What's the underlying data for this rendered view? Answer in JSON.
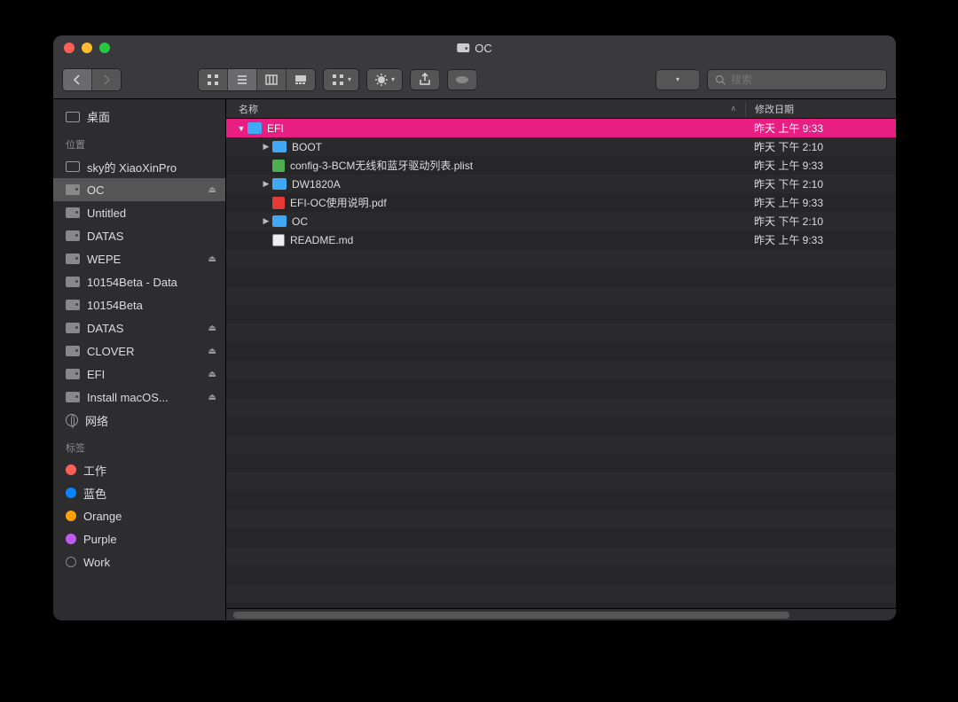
{
  "window_title": "OC",
  "search": {
    "placeholder": "搜索"
  },
  "toolbar": {
    "back": "‹",
    "forward": "›"
  },
  "sidebar": {
    "favorites_top": {
      "label": "桌面"
    },
    "locations_heading": "位置",
    "items": [
      {
        "label": "sky的 XiaoXinPro",
        "kind": "desktop",
        "eject": false
      },
      {
        "label": "OC",
        "kind": "drive",
        "eject": true,
        "selected": true
      },
      {
        "label": "Untitled",
        "kind": "drive",
        "eject": false
      },
      {
        "label": "DATAS",
        "kind": "drive",
        "eject": false
      },
      {
        "label": "WEPE",
        "kind": "drive",
        "eject": true
      },
      {
        "label": "10154Beta - Data",
        "kind": "drive",
        "eject": false
      },
      {
        "label": "10154Beta",
        "kind": "drive",
        "eject": false
      },
      {
        "label": "DATAS",
        "kind": "drive",
        "eject": true
      },
      {
        "label": "CLOVER",
        "kind": "drive",
        "eject": true
      },
      {
        "label": "EFI",
        "kind": "drive",
        "eject": true
      },
      {
        "label": "Install macOS...",
        "kind": "drive",
        "eject": true
      },
      {
        "label": "网络",
        "kind": "globe",
        "eject": false
      }
    ],
    "tags_heading": "标签",
    "tags": [
      {
        "label": "工作",
        "color": "#ff5f57"
      },
      {
        "label": "蓝色",
        "color": "#0a84ff"
      },
      {
        "label": "Orange",
        "color": "#ff9f0a"
      },
      {
        "label": "Purple",
        "color": "#bf5af2"
      },
      {
        "label": "Work",
        "color": ""
      }
    ]
  },
  "columns": {
    "name": "名称",
    "date": "修改日期"
  },
  "rows": [
    {
      "depth": 0,
      "disclosure": "▼",
      "icon": "folder",
      "name": "EFI",
      "date": "昨天 上午 9:33",
      "selected": true
    },
    {
      "depth": 1,
      "disclosure": "▶",
      "icon": "folder",
      "name": "BOOT",
      "date": "昨天 下午 2:10"
    },
    {
      "depth": 1,
      "disclosure": "",
      "icon": "plist",
      "name": "config-3-BCM无线和蓝牙驱动列表.plist",
      "date": "昨天 上午 9:33"
    },
    {
      "depth": 1,
      "disclosure": "▶",
      "icon": "folder",
      "name": "DW1820A",
      "date": "昨天 下午 2:10"
    },
    {
      "depth": 1,
      "disclosure": "",
      "icon": "pdf",
      "name": "EFI-OC使用说明.pdf",
      "date": "昨天 上午 9:33"
    },
    {
      "depth": 1,
      "disclosure": "▶",
      "icon": "folder",
      "name": "OC",
      "date": "昨天 下午 2:10"
    },
    {
      "depth": 1,
      "disclosure": "",
      "icon": "md",
      "name": "README.md",
      "date": "昨天 上午 9:33"
    }
  ]
}
